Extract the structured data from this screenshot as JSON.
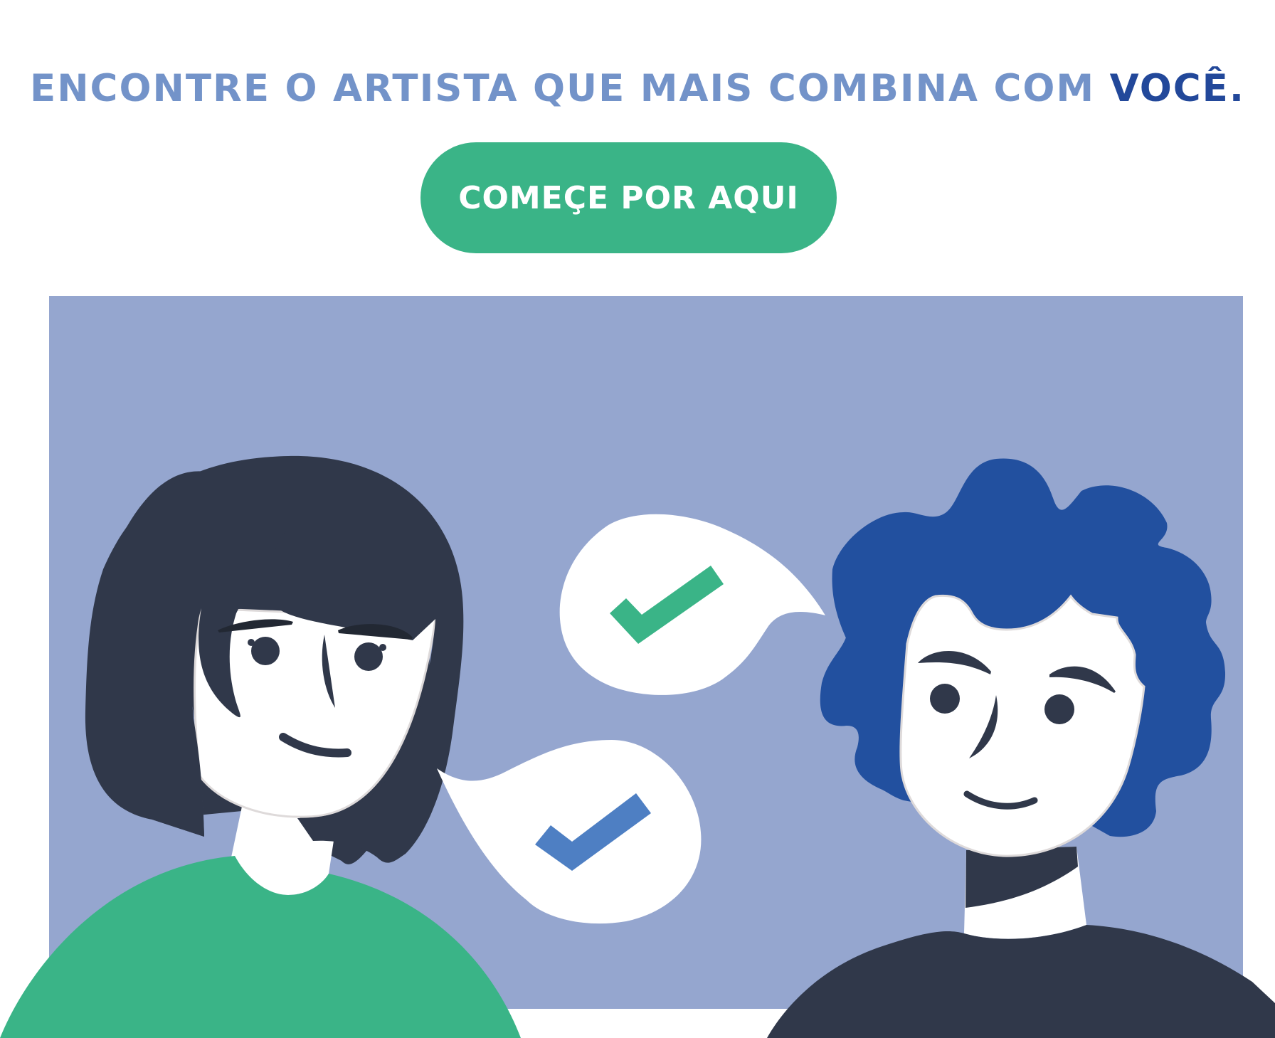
{
  "headline": {
    "text_before": "ENCONTRE O ARTISTA QUE MAIS COMBINA COM",
    "text_emphasis": "VOCÊ."
  },
  "cta": {
    "label": "COMEÇE POR AQUI"
  },
  "colors": {
    "headline": "#7393c9",
    "headline_emphasis": "#22489a",
    "button": "#3ab487",
    "panel": "#95a6cf",
    "dark": "#30384a",
    "curly_hair": "#22509f",
    "green_check": "#3ab487",
    "blue_check": "#4e7fc3"
  },
  "illustration": {
    "icons": [
      "check-icon",
      "check-icon"
    ]
  }
}
